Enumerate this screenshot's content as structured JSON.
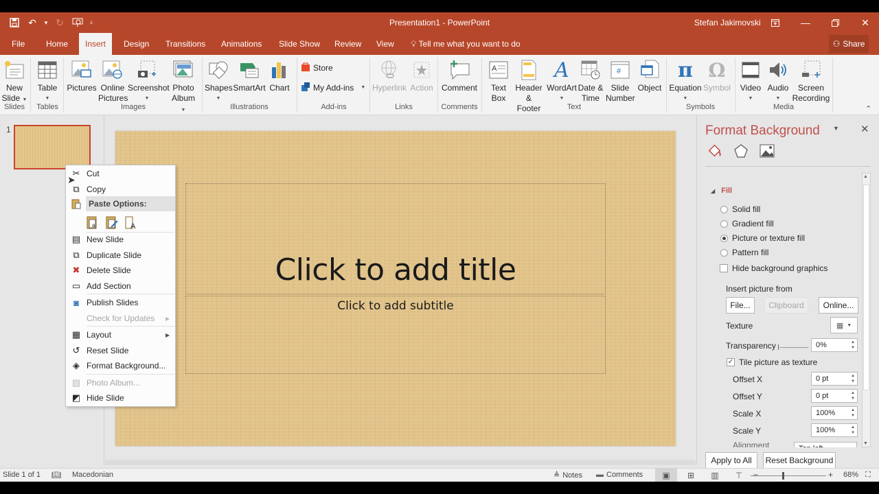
{
  "window": {
    "title": "Presentation1 - PowerPoint",
    "user": "Stefan Jakimovski"
  },
  "qat": {
    "save": "save-icon",
    "undo": "undo-icon",
    "redo": "redo-icon",
    "present": "start-from-beginning-icon",
    "customize": "customize-qat-icon"
  },
  "tabs": [
    {
      "label": "File"
    },
    {
      "label": "Home"
    },
    {
      "label": "Insert",
      "active": true
    },
    {
      "label": "Design"
    },
    {
      "label": "Transitions"
    },
    {
      "label": "Animations"
    },
    {
      "label": "Slide Show"
    },
    {
      "label": "Review"
    },
    {
      "label": "View"
    }
  ],
  "tell_me": "Tell me what you want to do",
  "share": "Share",
  "ribbon": {
    "groups": {
      "slides": "Slides",
      "tables": "Tables",
      "images": "Images",
      "illustrations": "Illustrations",
      "addins": "Add-ins",
      "links": "Links",
      "comments": "Comments",
      "text": "Text",
      "symbols": "Symbols",
      "media": "Media"
    },
    "buttons": {
      "new_slide_1": "New",
      "new_slide_2": "Slide",
      "table": "Table",
      "pictures": "Pictures",
      "online_pictures_1": "Online",
      "online_pictures_2": "Pictures",
      "screenshot": "Screenshot",
      "photo_album_1": "Photo",
      "photo_album_2": "Album",
      "shapes": "Shapes",
      "smartart": "SmartArt",
      "chart": "Chart",
      "store": "Store",
      "my_addins": "My Add-ins",
      "hyperlink": "Hyperlink",
      "action": "Action",
      "comment": "Comment",
      "text_box_1": "Text",
      "text_box_2": "Box",
      "header_footer_1": "Header",
      "header_footer_2": "& Footer",
      "wordart": "WordArt",
      "date_time_1": "Date &",
      "date_time_2": "Time",
      "slide_number_1": "Slide",
      "slide_number_2": "Number",
      "object": "Object",
      "equation": "Equation",
      "symbol": "Symbol",
      "video": "Video",
      "audio": "Audio",
      "screen_recording_1": "Screen",
      "screen_recording_2": "Recording"
    }
  },
  "thumbnails": [
    {
      "number": "1"
    }
  ],
  "slide": {
    "title_placeholder": "Click to add title",
    "subtitle_placeholder": "Click to add subtitle",
    "background_color": "#e3c68e"
  },
  "context_menu": {
    "items": [
      {
        "label": "Cut",
        "icon": "scissors-icon"
      },
      {
        "label": "Copy",
        "icon": "copy-icon"
      },
      {
        "label": "Paste Options:",
        "icon": "paste-icon"
      },
      {
        "label": "New Slide",
        "icon": "new-slide-icon"
      },
      {
        "label": "Duplicate Slide",
        "icon": "duplicate-slide-icon"
      },
      {
        "label": "Delete Slide",
        "icon": "delete-slide-icon"
      },
      {
        "label": "Add Section",
        "icon": "add-section-icon"
      },
      {
        "label": "Publish Slides",
        "icon": "publish-slides-icon"
      },
      {
        "label": "Check for Updates",
        "disabled": true
      },
      {
        "label": "Layout",
        "icon": "layout-icon"
      },
      {
        "label": "Reset Slide",
        "icon": "reset-slide-icon"
      },
      {
        "label": "Format Background...",
        "icon": "format-background-icon"
      },
      {
        "label": "Photo Album...",
        "icon": "photo-album-icon",
        "disabled": true
      },
      {
        "label": "Hide Slide",
        "icon": "hide-slide-icon"
      }
    ],
    "paste_options": [
      "use-destination-theme",
      "keep-source-formatting",
      "keep-text-only"
    ]
  },
  "format_background": {
    "title": "Format Background",
    "section": "Fill",
    "fill_options": [
      {
        "label": "Solid fill",
        "selected": false
      },
      {
        "label": "Gradient fill",
        "selected": false
      },
      {
        "label": "Picture or texture fill",
        "selected": true
      },
      {
        "label": "Pattern fill",
        "selected": false
      }
    ],
    "hide_background_graphics": {
      "label": "Hide background graphics",
      "checked": false
    },
    "insert_picture_from": "Insert picture from",
    "file_button": "File...",
    "clipboard_button": "Clipboard",
    "online_button": "Online...",
    "texture_label": "Texture",
    "transparency_label": "Transparency",
    "transparency_value": "0%",
    "tile_picture": {
      "label": "Tile picture as texture",
      "checked": true
    },
    "offset_x_label": "Offset X",
    "offset_x_value": "0 pt",
    "offset_y_label": "Offset Y",
    "offset_y_value": "0 pt",
    "scale_x_label": "Scale X",
    "scale_x_value": "100%",
    "scale_y_label": "Scale Y",
    "scale_y_value": "100%",
    "alignment_label": "Alignment",
    "alignment_value": "Top left",
    "apply_to_all": "Apply to All",
    "reset_background": "Reset Background"
  },
  "status": {
    "slide_count": "Slide 1 of 1",
    "language": "Macedonian",
    "notes": "Notes",
    "comments": "Comments",
    "zoom": "68%"
  },
  "colors": {
    "accent": "#b7472a",
    "pane_title": "#c0504d"
  }
}
